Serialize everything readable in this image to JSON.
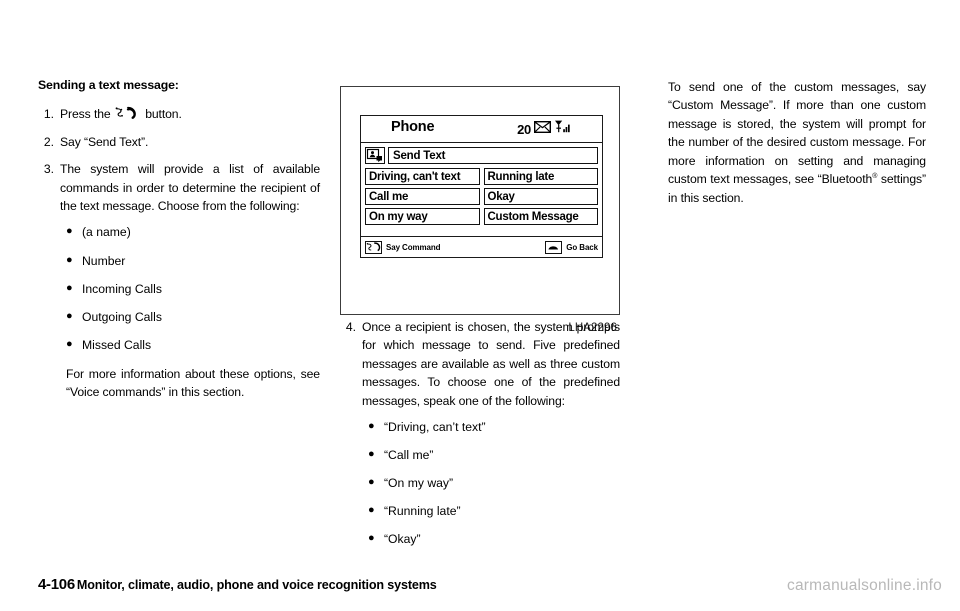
{
  "document": {
    "footer_page_number": "4-106",
    "footer_title": "Monitor, climate, audio, phone and voice recognition systems",
    "watermark": "carmanualsonline.info"
  },
  "left_column": {
    "heading": "Sending a text message:",
    "steps": [
      {
        "number": "1.",
        "text_before_icon": "Press the",
        "icon": "talk-button-icon",
        "text_after_icon": "button."
      },
      {
        "number": "2.",
        "text": "Say “Send Text”."
      },
      {
        "number": "3.",
        "text": "The system will provide a list of available commands in order to determine the recipient of the text message. Choose from the following:"
      }
    ],
    "recipient_options": [
      "(a name)",
      "Number",
      "Incoming Calls",
      "Outgoing Calls",
      "Missed Calls"
    ],
    "closing_paragraph": "For more information about these options, see “Voice commands” in this section."
  },
  "illustration": {
    "caption": "LHA2296",
    "screen": {
      "title": "Phone",
      "message_count": "20",
      "envelope_icon": "envelope-icon",
      "signal_icon": "signal-bars-icon",
      "send_text_icon": "send-text-icon",
      "send_text_label": "Send Text",
      "message_buttons": [
        "Driving, can't text",
        "Running late",
        "Call me",
        "Okay",
        "On my way",
        "Custom Message"
      ],
      "footer_left_icon": "say-command-icon",
      "footer_left_label": "Say Command",
      "footer_right_icon": "go-back-icon",
      "footer_right_label": "Go Back"
    }
  },
  "middle_column": {
    "step": {
      "number": "4.",
      "text": "Once a recipient is chosen, the system prompts for which message to send. Five predefined messages are available as well as three custom messages. To choose one of the predefined messages, speak one of the following:"
    },
    "predefined_messages": [
      "“Driving, can’t text”",
      "“Call me”",
      "“On my way”",
      "“Running late”",
      "“Okay”"
    ]
  },
  "right_column": {
    "paragraph_part1": "To send one of the custom messages, say “Custom Message”. If more than one custom message is stored, the system will prompt for the number of the desired custom message. For more information on setting and managing custom text messages, see “Bluetooth",
    "registered_mark": "®",
    "paragraph_part2": " settings” in this section."
  }
}
